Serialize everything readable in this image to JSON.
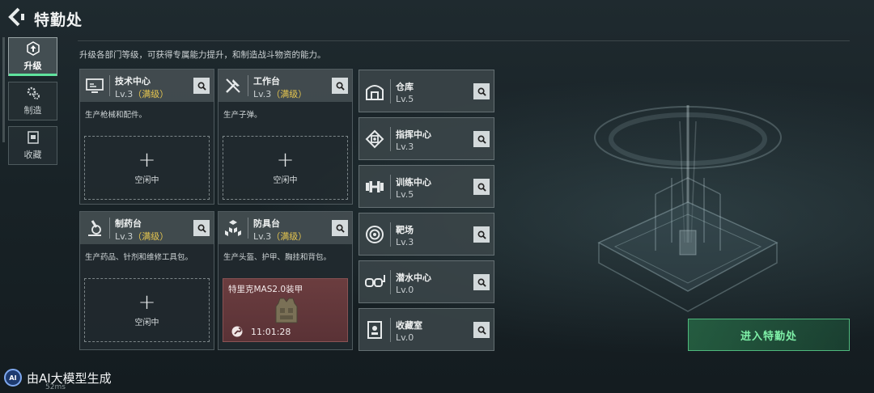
{
  "header": {
    "title": "特勤处",
    "subtitle": "升级各部门等级，可获得专属能力提升，和制造战斗物资的能力。"
  },
  "tabs": [
    {
      "label": "升级",
      "icon": "upgrade-icon",
      "active": true
    },
    {
      "label": "制造",
      "icon": "gears-icon",
      "active": false
    },
    {
      "label": "收藏",
      "icon": "collection-icon",
      "active": false
    }
  ],
  "cards": [
    {
      "name": "技术中心",
      "level": "Lv.3",
      "max_tag": "（满级）",
      "desc": "生产枪械和配件。",
      "icon": "monitor-icon",
      "slot": {
        "state": "idle",
        "plus": "+",
        "text": "空闲中"
      }
    },
    {
      "name": "工作台",
      "level": "Lv.3",
      "max_tag": "（满级）",
      "desc": "生产子弹。",
      "icon": "tools-icon",
      "slot": {
        "state": "idle",
        "plus": "+",
        "text": "空闲中"
      }
    },
    {
      "name": "制药台",
      "level": "Lv.3",
      "max_tag": "（满级）",
      "desc": "生产药品、针剂和维修工具包。",
      "icon": "microscope-icon",
      "slot": {
        "state": "idle",
        "plus": "+",
        "text": "空闲中"
      }
    },
    {
      "name": "防具台",
      "level": "Lv.3",
      "max_tag": "（满级）",
      "desc": "生产头盔、护甲、胸挂和背包。",
      "icon": "cubes-icon",
      "slot": {
        "state": "crafting",
        "item_name": "特里克MAS2.0装甲",
        "timer": "11:01:28",
        "item_icon": "armor-vest-icon"
      }
    }
  ],
  "buildings": [
    {
      "name": "仓库",
      "level": "Lv.5",
      "icon": "warehouse-icon"
    },
    {
      "name": "指挥中心",
      "level": "Lv.3",
      "icon": "chip-icon"
    },
    {
      "name": "训练中心",
      "level": "Lv.5",
      "icon": "dumbbell-icon"
    },
    {
      "name": "靶场",
      "level": "Lv.3",
      "icon": "target-icon"
    },
    {
      "name": "潜水中心",
      "level": "Lv.0",
      "icon": "diving-mask-icon"
    },
    {
      "name": "收藏室",
      "level": "Lv.0",
      "icon": "trophy-case-icon"
    }
  ],
  "enter_button": "进入特勤处",
  "watermark": {
    "badge": "AI",
    "text": "由AI大模型生成",
    "net": "52ms"
  },
  "colors": {
    "accent_green": "#5fe39e",
    "max_level_yellow": "#e6c64f",
    "crafting_bg": "#6b3d3f"
  }
}
